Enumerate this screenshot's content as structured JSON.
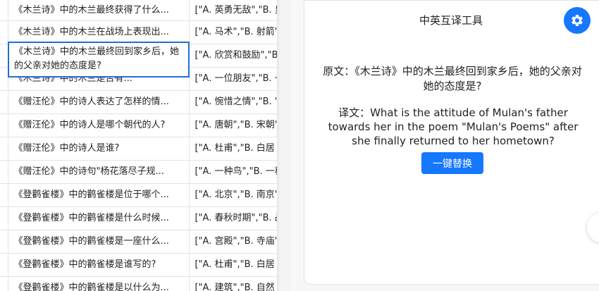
{
  "sheet": {
    "rows": [
      {
        "question": "《木兰诗》中的木兰最终获得了什么...",
        "options": "[\"A. 英勇无敌\",\"B. 皇"
      },
      {
        "question": "《木兰诗》中的木兰在战场上表现出...",
        "options": "[\"A. 马术\",\"B. 射箭\""
      },
      {
        "question": "",
        "options": "[\"A. 欣赏和鼓励\",\"B"
      },
      {
        "question": "《木兰诗》中的木兰是否有...",
        "options": "[\"A. 一位朋友\",\"B. 一"
      },
      {
        "question": "《赠汪伦》中的诗人表达了怎样的情...",
        "options": "[\"A. 惋惜之情\",\"B. '"
      },
      {
        "question": "《赠汪伦》中的诗人是哪个朝代的人?",
        "options": "[\"A. 唐朝\",\"B. 宋朝\""
      },
      {
        "question": "《赠汪伦》中的诗人是谁?",
        "options": "[\"A. 杜甫\",\"B. 白居"
      },
      {
        "question": "《赠汪伦》中的诗句\"杨花落尽子规...",
        "options": "[\"A. 一种鸟\",\"B. 一种"
      },
      {
        "question": "《登鹳雀楼》中的鹳雀楼是位于哪个...",
        "options": "[\"A. 北京\",\"B. 南京\""
      },
      {
        "question": "《登鹳雀楼》中的鹳雀楼是什么时候...",
        "options": "[\"A. 春秋时期\",\"B. 战"
      },
      {
        "question": "《登鹳雀楼》中的鹳雀楼是一座什么...",
        "options": "[\"A. 宫殿\",\"B. 寺庙\""
      },
      {
        "question": "《登鹳雀楼》中的鹳雀楼是谁写的?",
        "options": "[\"A. 杜甫\",\"B. 白居"
      },
      {
        "question": "《登鹳雀楼》中的鹳雀楼是以什么为...",
        "options": "[\"A. 建筑\",\"B. 自然"
      }
    ],
    "active_cell_text": "《木兰诗》中的木兰最终回到家乡后，她的父亲对她的态度是?"
  },
  "panel": {
    "title": "中英互译工具",
    "source": "原文：《木兰诗》中的木兰最终回到家乡后，她的父亲对她的态度是?",
    "target": "译文：What is the attitude of Mulan's father towards her in the poem \"Mulan's Poems\" after she finally returned to her hometown?",
    "replace_label": "一键替换",
    "gear_icon": "gear-icon",
    "accent_color": "#1677ff"
  }
}
